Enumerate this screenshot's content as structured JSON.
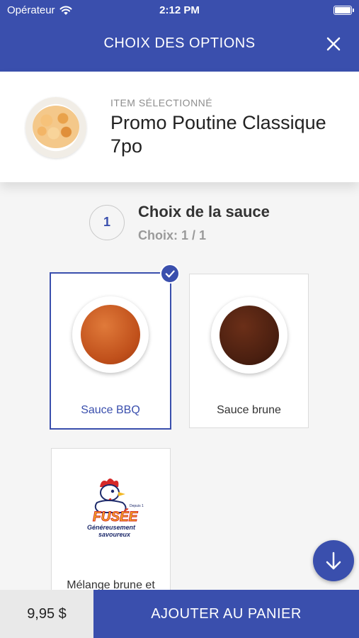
{
  "status_bar": {
    "carrier": "Opérateur",
    "time": "2:12 PM"
  },
  "header": {
    "title": "CHOIX DES OPTIONS"
  },
  "item": {
    "label": "ITEM SÉLECTIONNÉ",
    "name": "Promo Poutine Classique 7po"
  },
  "step": {
    "number": "1",
    "title": "Choix de la sauce",
    "subtitle": "Choix: 1 / 1"
  },
  "options": [
    {
      "label": "Sauce BBQ",
      "selected": true,
      "color": "#c8541a"
    },
    {
      "label": "Sauce brune",
      "selected": false,
      "color": "#4a1f10"
    },
    {
      "label": "Mélange brune et",
      "selected": false
    }
  ],
  "logo": {
    "brand": "FUSÉE",
    "tagline_1": "Généreusement",
    "tagline_2": "savoureux",
    "since": "Depuis 1993"
  },
  "footer": {
    "price": "9,95 $",
    "add_label": "AJOUTER AU PANIER"
  },
  "colors": {
    "brand": "#3a4fad"
  }
}
